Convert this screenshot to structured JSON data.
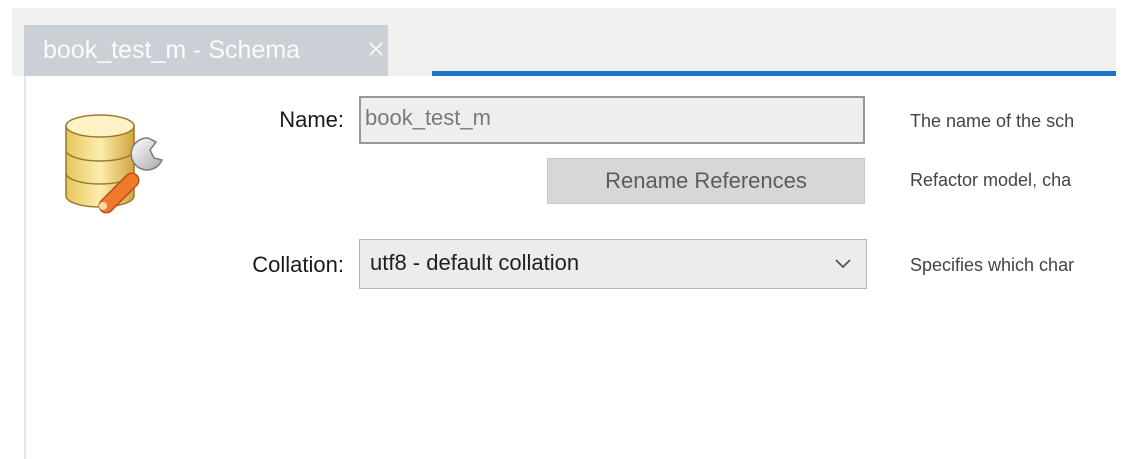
{
  "tab": {
    "title": "book_test_m - Schema",
    "close_icon": "close-icon"
  },
  "colors": {
    "accent": "#1e73c8",
    "tab_background": "#cbcfd6"
  },
  "schema_icon": "database-schema-icon",
  "form": {
    "name_label": "Name:",
    "name_value": "book_test_m",
    "rename_button_label": "Rename References",
    "collation_label": "Collation:",
    "collation_value": "utf8 - default collation"
  },
  "descriptions": {
    "name_desc": "The name of the sch",
    "rename_desc_part1": "Refactor model",
    "rename_desc_comma": ",",
    "rename_desc_part2": " cha",
    "collation_desc": "Specifies which char"
  }
}
